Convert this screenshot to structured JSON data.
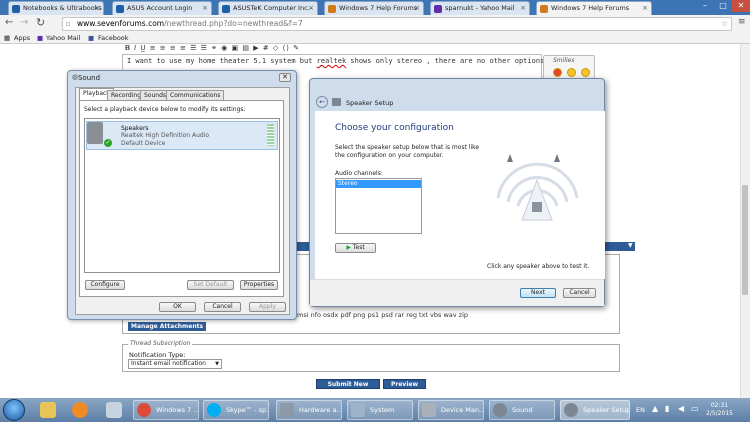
{
  "browser": {
    "tabs": [
      {
        "label": "Notebooks & Ultrabooks",
        "color": "#1f5ea8"
      },
      {
        "label": "ASUS Account Login",
        "color": "#1f5ea8"
      },
      {
        "label": "ASUSTeK Computer Inc.-",
        "color": "#1f5ea8"
      },
      {
        "label": "Windows 7 Help Forums",
        "color": "#d07a1c"
      },
      {
        "label": "sparnukt - Yahoo Mail",
        "color": "#5f2ea8"
      },
      {
        "label": "Windows 7 Help Forums",
        "color": "#d07a1c",
        "active": true
      }
    ],
    "url_host": "www.sevenforums.com",
    "url_path": "/newthread.php?do=newthread&f=7",
    "bookmarks": [
      "Apps",
      "Yahoo Mail",
      "Facebook"
    ]
  },
  "page": {
    "editor_text_before": "I want to use my home theater 5.1 system but ",
    "editor_text_misspelled": "realtek",
    "editor_text_after": " shows only stereo , there are no other options.",
    "smilies_label": "Smilies",
    "filetypes": "msi nfo osdx pdf png ps1 psd rar reg txt vbs wav zip",
    "manage_attachments": "Manage Attachments",
    "thread_subscription_legend": "Thread Subscription",
    "notification_label": "Notification Type:",
    "notification_value": "Instant email notification",
    "submit_label": "Submit New Thread",
    "preview_label": "Preview Post"
  },
  "sound_dialog": {
    "title": "Sound",
    "tabs": [
      "Playback",
      "Recording",
      "Sounds",
      "Communications"
    ],
    "instruction": "Select a playback device below to modify its settings:",
    "device_name": "Speakers",
    "device_driver": "Realtek High Definition Audio",
    "device_status": "Default Device",
    "configure_label": "Configure",
    "set_default_label": "Set Default",
    "properties_label": "Properties",
    "ok_label": "OK",
    "cancel_label": "Cancel",
    "apply_label": "Apply"
  },
  "speaker_setup": {
    "title": "Speaker Setup",
    "heading": "Choose your configuration",
    "description": "Select the speaker setup below that is most like the configuration on your computer.",
    "channels_label": "Audio channels:",
    "channels_selected": "Stereo",
    "test_label": "Test",
    "hint": "Click any speaker above to test it.",
    "next_label": "Next",
    "cancel_label": "Cancel"
  },
  "taskbar": {
    "buttons": [
      {
        "label": "Windows 7 ...",
        "icon": "chrome-icon"
      },
      {
        "label": "Skype™ - sp...",
        "icon": "skype-icon"
      },
      {
        "label": "Hardware a...",
        "icon": "hardware-icon"
      },
      {
        "label": "System",
        "icon": "system-icon"
      },
      {
        "label": "Device Man...",
        "icon": "device-manager-icon"
      },
      {
        "label": "Sound",
        "icon": "sound-icon"
      },
      {
        "label": "Speaker Setup",
        "icon": "speaker-setup-icon",
        "active": true
      }
    ],
    "language": "EN",
    "time": "02:31",
    "date": "2/5/2015"
  }
}
